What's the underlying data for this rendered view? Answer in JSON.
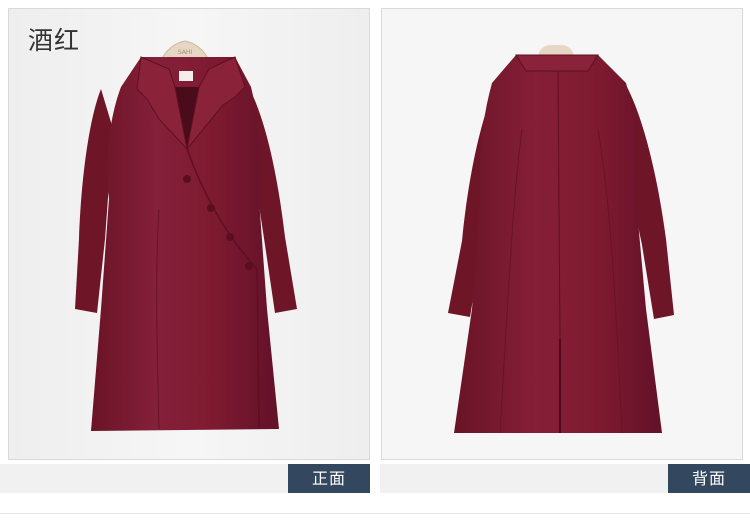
{
  "product": {
    "color_name": "酒红",
    "front_label": "正面",
    "back_label": "背面"
  },
  "colors": {
    "coat": "#7e1a30",
    "coat_shadow": "#5e0f22",
    "coat_highlight": "#96283f",
    "tag_bg": "#33475e",
    "panel_bg": "#f1f1f1"
  },
  "icons": {
    "hanger": "hanger-icon",
    "button": "coat-button"
  }
}
